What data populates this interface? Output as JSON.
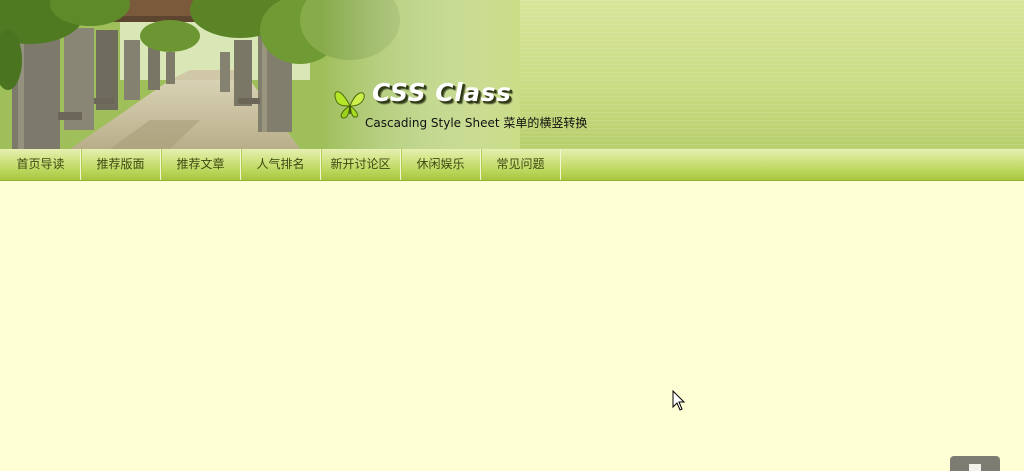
{
  "header": {
    "title": "CSS Class",
    "subtitle": "Cascading Style Sheet 菜单的横竖转换",
    "logo_icon": "butterfly-icon",
    "colors": {
      "banner_green": "#cadd86",
      "title_text": "#ffffff",
      "title_shadow": "#2e3a12"
    }
  },
  "nav": {
    "items": [
      {
        "label": "首页导读"
      },
      {
        "label": "推荐版面"
      },
      {
        "label": "推荐文章"
      },
      {
        "label": "人气排名"
      },
      {
        "label": "新开讨论区"
      },
      {
        "label": "休闲娱乐"
      },
      {
        "label": "常见问题"
      }
    ],
    "colors": {
      "bar_top": "#e6f0b2",
      "bar_bottom": "#a8c63f",
      "text": "#3b4a12"
    }
  },
  "page": {
    "background": "#ffffd6"
  },
  "overlay": {
    "cursor_icon": "mouse-pointer-icon",
    "corner_button_icon": "scroll-top-icon"
  }
}
